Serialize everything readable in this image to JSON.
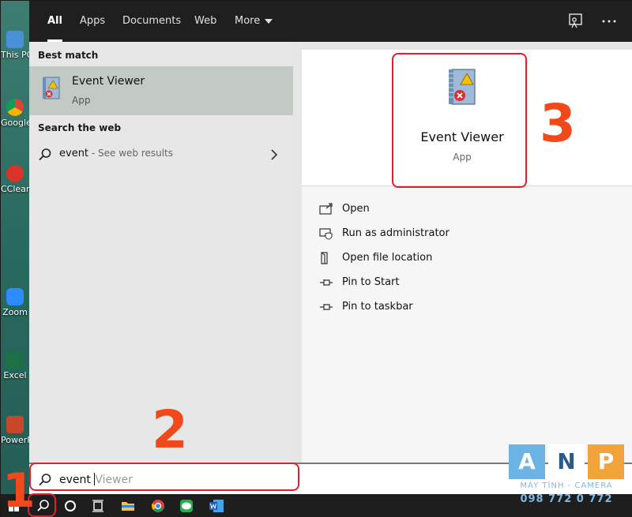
{
  "desktop": {
    "icons": [
      {
        "label": "This PC"
      },
      {
        "label": "Google Chrome"
      },
      {
        "label": "CCleaner"
      },
      {
        "label": "Zoom"
      },
      {
        "label": "Excel"
      },
      {
        "label": "PowerPoint"
      }
    ]
  },
  "filter_bar": {
    "tabs": [
      {
        "label": "All",
        "active": true
      },
      {
        "label": "Apps"
      },
      {
        "label": "Documents"
      },
      {
        "label": "Web"
      },
      {
        "label": "More"
      }
    ],
    "feedback_icon": "feedback-icon",
    "more_options_icon": "ellipsis-icon"
  },
  "results": {
    "best_match_title": "Best match",
    "best_match": {
      "name": "Event Viewer",
      "type": "App",
      "icon": "event-viewer-icon"
    },
    "search_web_title": "Search the web",
    "web_result": {
      "query": "event",
      "suffix": " - See web results"
    }
  },
  "preview": {
    "name": "Event Viewer",
    "type": "App",
    "actions": [
      {
        "label": "Open",
        "icon": "open-icon"
      },
      {
        "label": "Run as administrator",
        "icon": "shield-icon"
      },
      {
        "label": "Open file location",
        "icon": "file-location-icon"
      },
      {
        "label": "Pin to Start",
        "icon": "pin-icon"
      },
      {
        "label": "Pin to taskbar",
        "icon": "pin-icon"
      }
    ]
  },
  "search": {
    "typed": "event",
    "suggestion": "Viewer"
  },
  "annotations": {
    "step1": "1",
    "step2": "2",
    "step3": "3"
  },
  "watermark": {
    "letters": [
      "A",
      "N",
      "P"
    ],
    "line1": "MÁY TÍNH - CAMERA",
    "line2": "098 772 0 772"
  },
  "colors": {
    "annotation_red": "#e0202a",
    "number_orange": "#f04a1c",
    "selected_row": "#c3c9c4"
  }
}
